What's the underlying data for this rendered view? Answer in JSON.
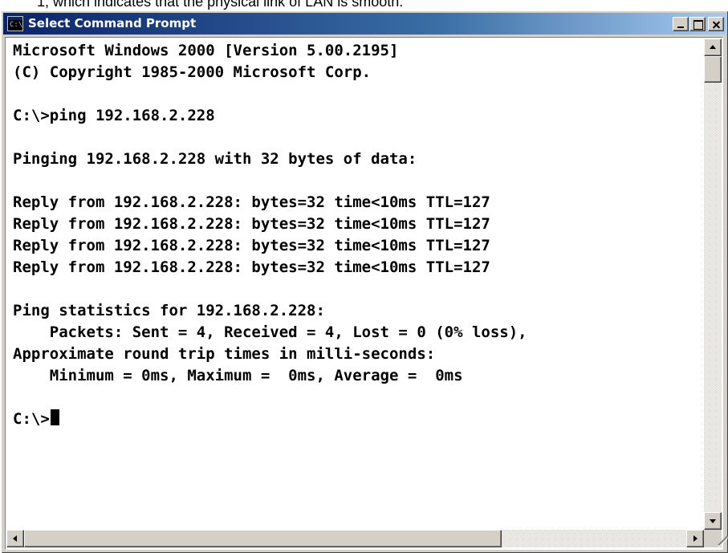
{
  "caption": "1, which indicates that the physical link of LAN is smooth.",
  "window": {
    "title": "Select Command Prompt",
    "icon": "command-prompt-icon",
    "icon_text": "C:\\",
    "buttons": {
      "minimize": "minimize-icon",
      "maximize": "maximize-icon",
      "close": "close-icon"
    }
  },
  "console": {
    "lines": [
      "Microsoft Windows 2000 [Version 5.00.2195]",
      "(C) Copyright 1985-2000 Microsoft Corp.",
      "",
      "C:\\>ping 192.168.2.228",
      "",
      "Pinging 192.168.2.228 with 32 bytes of data:",
      "",
      "Reply from 192.168.2.228: bytes=32 time<10ms TTL=127",
      "Reply from 192.168.2.228: bytes=32 time<10ms TTL=127",
      "Reply from 192.168.2.228: bytes=32 time<10ms TTL=127",
      "Reply from 192.168.2.228: bytes=32 time<10ms TTL=127",
      "",
      "Ping statistics for 192.168.2.228:",
      "    Packets: Sent = 4, Received = 4, Lost = 0 (0% loss),",
      "Approximate round trip times in milli-seconds:",
      "    Minimum = 0ms, Maximum =  0ms, Average =  0ms",
      "",
      "C:\\>"
    ]
  },
  "colors": {
    "titlebar_start": "#0a246a",
    "titlebar_end": "#a6caf0",
    "chrome": "#d4d0c8",
    "console_bg": "#ffffff",
    "console_text": "#000000"
  }
}
